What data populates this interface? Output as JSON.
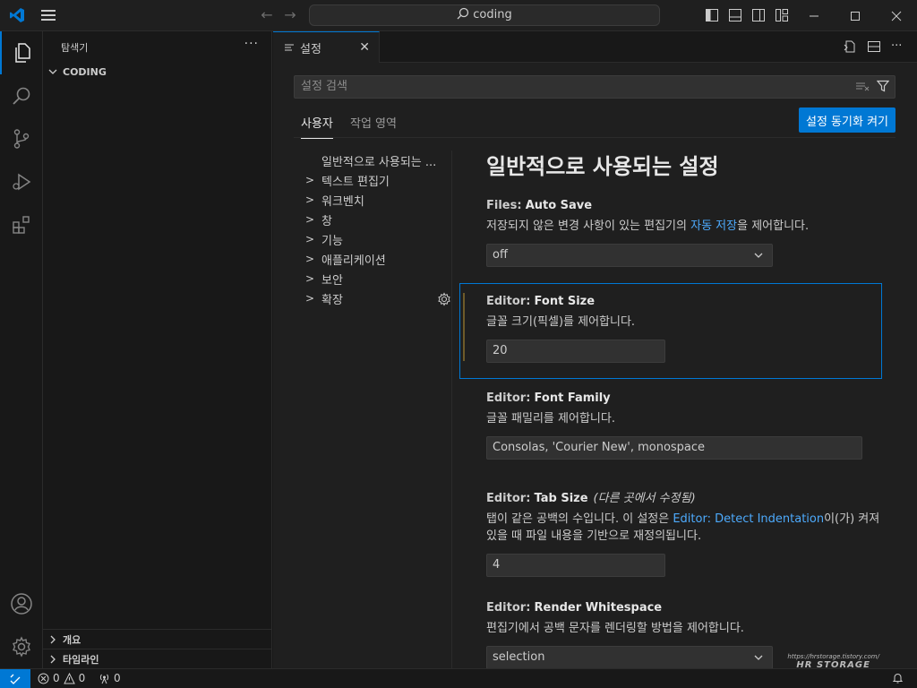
{
  "titlebar": {
    "search_text": "coding"
  },
  "sidebar": {
    "title": "탐색기",
    "more": "···",
    "folder": "CODING",
    "sections": [
      "개요",
      "타임라인"
    ]
  },
  "editor_tab": {
    "label": "설정"
  },
  "settings": {
    "search_placeholder": "설정 검색",
    "scopes": [
      "사용자",
      "작업 영역"
    ],
    "sync_button": "설정 동기화 켜기",
    "toc": {
      "heading": "일반적으로 사용되는 ...",
      "items": [
        "텍스트 편집기",
        "워크벤치",
        "창",
        "기능",
        "애플리케이션",
        "보안",
        "확장"
      ]
    },
    "page_heading": "일반적으로 사용되는 설정",
    "items": [
      {
        "category": "Files:",
        "name": "Auto Save",
        "desc_before": "저장되지 않은 변경 사항이 있는 편집기의 ",
        "desc_link": "자동 저장",
        "desc_after": "을 제어합니다.",
        "value": "off"
      },
      {
        "category": "Editor:",
        "name": "Font Size",
        "desc": "글꼴 크기(픽셀)를 제어합니다.",
        "value": "20"
      },
      {
        "category": "Editor:",
        "name": "Font Family",
        "desc": "글꼴 패밀리를 제어합니다.",
        "value": "Consolas, 'Courier New', monospace"
      },
      {
        "category": "Editor:",
        "name": "Tab Size",
        "modified": "(다른 곳에서 수정됨)",
        "desc_before": "탭이 같은 공백의 수입니다. 이 설정은 ",
        "desc_link": "Editor: Detect Indentation",
        "desc_after": "이(가) 켜져 있을 때 파일 내용을 기반으로 재정의됩니다.",
        "value": "4"
      },
      {
        "category": "Editor:",
        "name": "Render Whitespace",
        "desc": "편집기에서 공백 문자를 렌더링할 방법을 제어합니다.",
        "value": "selection"
      }
    ]
  },
  "statusbar": {
    "errors": "0",
    "warnings": "0",
    "ports": "0"
  },
  "watermark": {
    "url": "https://hrstorage.tistory.com/",
    "name": "HR STORAGE"
  },
  "colors": {
    "accent": "#0078d4",
    "link": "#4daafc",
    "background": "#1f1f1f"
  }
}
